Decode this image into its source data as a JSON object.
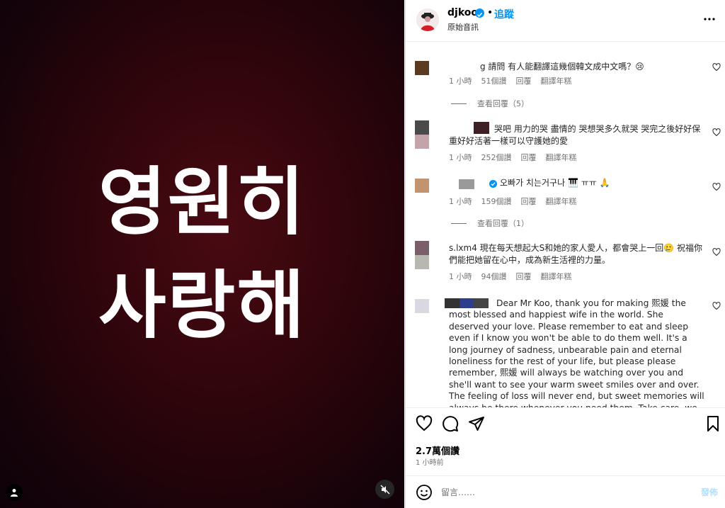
{
  "media": {
    "line1": "영원히",
    "line2": "사랑해"
  },
  "header": {
    "username": "djkoo",
    "separator": "•",
    "follow_label": "追蹤",
    "subtitle": "原始音訊",
    "more_icon": "more-horizontal-icon"
  },
  "comments": [
    {
      "text": "g 請問 有人能翻譯這幾個韓文成中文嗎？😢",
      "time": "1 小時",
      "likes": "51個讚",
      "reply": "回覆",
      "translate": "翻譯年糕",
      "replies_label": "查看回覆（5）"
    },
    {
      "text": "哭吧 用力的哭 盡情的 哭想哭多久就哭 哭完之後好好保重好好活著一樣可以守護她的愛",
      "time": "1 小時",
      "likes": "252個讚",
      "reply": "回覆",
      "translate": "翻譯年糕"
    },
    {
      "text": "오빠가 치는거구나 🎹 ㅠㅠ 🙏",
      "time": "1 小時",
      "likes": "159個讚",
      "reply": "回覆",
      "translate": "翻譯年糕",
      "replies_label": "查看回覆（1）"
    },
    {
      "text": "s.lxm4 現在每天想起大S和她的家人愛人，都會哭上一回🥲 祝福你們能把她留在心中，成為新生活裡的力量。",
      "time": "1 小時",
      "likes": "94個讚",
      "reply": "回覆",
      "translate": "翻譯年糕"
    },
    {
      "text": "Dear Mr Koo, thank you for making 熙媛 the most blessed and happiest wife in the world. She deserved your love. Please remember to eat and sleep even if I know you won't be able to do them well. It's a long journey of sadness, unbearable pain and eternal loneliness for the rest of your life, but please please remember, 熙媛 will always be watching over you and she'll want to see your warm sweet smiles over and over. The feeling of loss will never end, but sweet memories will always be there whenever you need them. Take care, we all love you"
    }
  ],
  "actions": {
    "likes_count": "2.7萬個讚",
    "posted_time": "1 小時前"
  },
  "composer": {
    "placeholder": "留言……",
    "post_label": "發佈"
  },
  "colors": {
    "accent": "#0095f6",
    "media_bg": "#2e050b"
  }
}
